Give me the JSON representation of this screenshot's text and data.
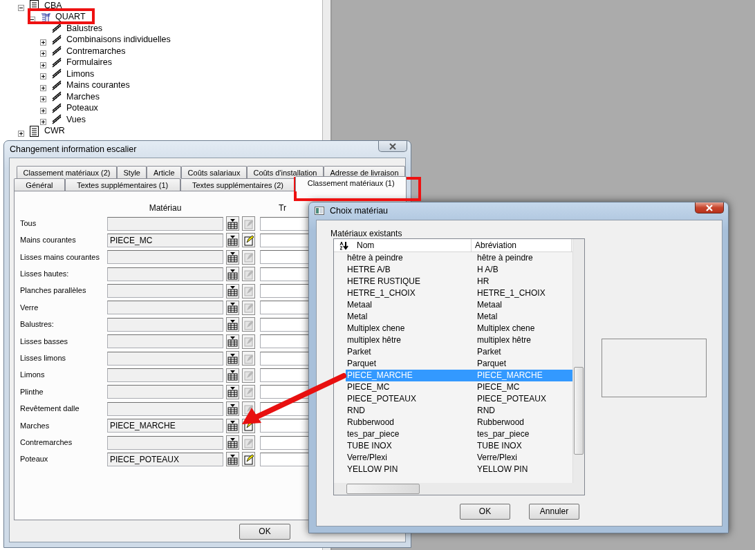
{
  "tree": {
    "items": [
      {
        "label": "CBA",
        "expanded": true,
        "children": [
          {
            "label": "QUART",
            "expanded": true,
            "children": [
              {
                "label": "Balustres"
              },
              {
                "label": "Combinaisons individuelles",
                "expanded": false
              },
              {
                "label": "Contremarches",
                "expanded": false
              },
              {
                "label": "Formulaires",
                "expanded": false
              },
              {
                "label": "Limons",
                "expanded": false
              },
              {
                "label": "Mains courantes",
                "expanded": false
              },
              {
                "label": "Marches",
                "expanded": false
              },
              {
                "label": "Poteaux",
                "expanded": false
              },
              {
                "label": "Vues",
                "expanded": false
              }
            ]
          }
        ]
      },
      {
        "label": "CWR",
        "expanded": false
      }
    ]
  },
  "main_dialog": {
    "title": "Changement information escalier",
    "tabs_row_1": [
      {
        "label": "Classement matériaux (2)",
        "selected": false
      },
      {
        "label": "Style",
        "selected": false
      },
      {
        "label": "Article",
        "selected": false
      },
      {
        "label": "Coûts salariaux",
        "selected": false
      },
      {
        "label": "Coûts d'installation",
        "selected": false
      },
      {
        "label": "Adresse de livraison",
        "selected": false
      }
    ],
    "tabs_row_2": [
      {
        "label": "Général",
        "selected": false
      },
      {
        "label": "Textes supplémentaires (1)",
        "selected": false
      },
      {
        "label": "Textes supplémentaires (2)",
        "selected": false
      },
      {
        "label": "Classement matériaux (1)",
        "selected": true
      }
    ],
    "column_headers": [
      "Matériau",
      "Tr"
    ],
    "rows": [
      {
        "label": "Tous",
        "value": "",
        "editable": false
      },
      {
        "label": "Mains courantes",
        "value": "PIECE_MC",
        "editable": true
      },
      {
        "label": "Lisses mains courantes",
        "value": "",
        "editable": false
      },
      {
        "label": "Lisses hautes:",
        "value": "",
        "editable": false
      },
      {
        "label": "Planches parallèles",
        "value": "",
        "editable": false
      },
      {
        "label": "Verre",
        "value": "",
        "editable": false
      },
      {
        "label": "Balustres:",
        "value": "",
        "editable": false
      },
      {
        "label": "Lisses basses",
        "value": "",
        "editable": false
      },
      {
        "label": "Lisses limons",
        "value": "",
        "editable": false
      },
      {
        "label": "Limons",
        "value": "",
        "editable": false
      },
      {
        "label": "Plinthe",
        "value": "",
        "editable": false
      },
      {
        "label": "Revêtement dalle",
        "value": "",
        "editable": false
      },
      {
        "label": "Marches",
        "value": "PIECE_MARCHE",
        "editable": true
      },
      {
        "label": "Contremarches",
        "value": "",
        "editable": false
      },
      {
        "label": "Poteaux",
        "value": "PIECE_POTEAUX",
        "editable": true
      }
    ],
    "buttons": [
      "OK"
    ]
  },
  "material_dialog": {
    "title": "Choix matériau",
    "group_label": "Matériaux existants",
    "columns": [
      "Nom",
      "Abréviation"
    ],
    "rows": [
      {
        "name": "hêtre à peindre",
        "abbreviation": "hêtre à peindre",
        "selected": false
      },
      {
        "name": "HETRE A/B",
        "abbreviation": "H A/B",
        "selected": false
      },
      {
        "name": "HETRE RUSTIQUE",
        "abbreviation": "HR",
        "selected": false
      },
      {
        "name": "HETRE_1_CHOIX",
        "abbreviation": "HETRE_1_CHOIX",
        "selected": false
      },
      {
        "name": "Metaal",
        "abbreviation": "Metaal",
        "selected": false
      },
      {
        "name": "Metal",
        "abbreviation": "Metal",
        "selected": false
      },
      {
        "name": "Multiplex chene",
        "abbreviation": "Multiplex chene",
        "selected": false
      },
      {
        "name": "multiplex hêtre",
        "abbreviation": "multiplex hêtre",
        "selected": false
      },
      {
        "name": "Parket",
        "abbreviation": "Parket",
        "selected": false
      },
      {
        "name": "Parquet",
        "abbreviation": "Parquet",
        "selected": false
      },
      {
        "name": "PIECE_MARCHE",
        "abbreviation": "PIECE_MARCHE",
        "selected": true
      },
      {
        "name": "PIECE_MC",
        "abbreviation": "PIECE_MC",
        "selected": false
      },
      {
        "name": "PIECE_POTEAUX",
        "abbreviation": "PIECE_POTEAUX",
        "selected": false
      },
      {
        "name": "RND",
        "abbreviation": "RND",
        "selected": false
      },
      {
        "name": "Rubberwood",
        "abbreviation": "Rubberwood",
        "selected": false
      },
      {
        "name": "tes_par_piece",
        "abbreviation": "tes_par_piece",
        "selected": false
      },
      {
        "name": "TUBE INOX",
        "abbreviation": "TUBE INOX",
        "selected": false
      },
      {
        "name": "Verre/Plexi",
        "abbreviation": "Verre/Plexi",
        "selected": false
      },
      {
        "name": "YELLOW PIN",
        "abbreviation": "YELLOW PIN",
        "selected": false
      }
    ],
    "buttons": [
      "OK",
      "Annuler"
    ]
  }
}
